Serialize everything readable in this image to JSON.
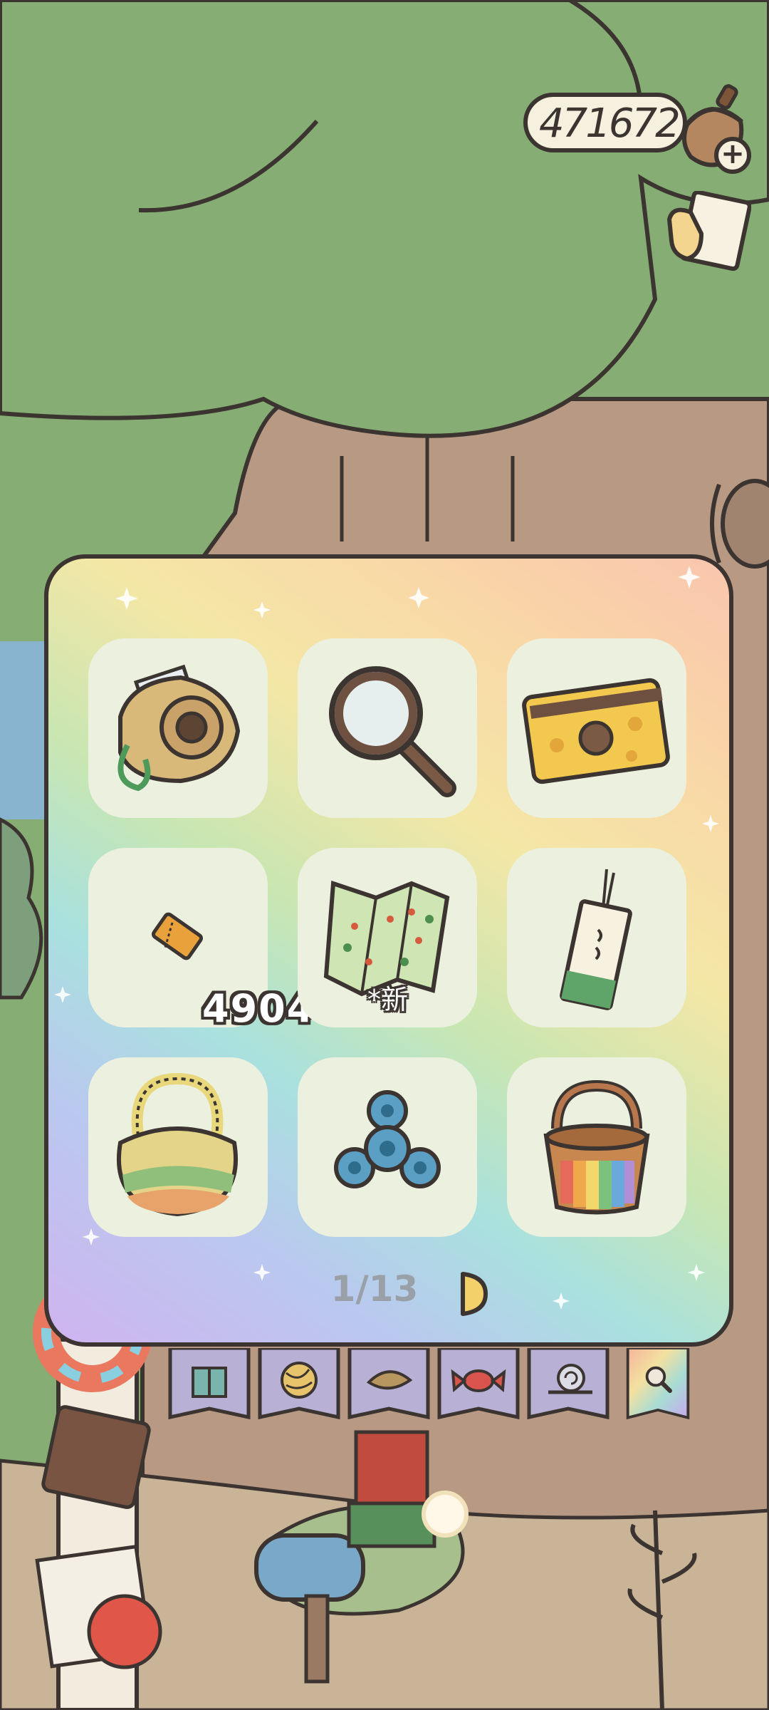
{
  "header": {
    "currency_value": "471672",
    "currency_icon": "acorn-icon",
    "add_icon": "plus-icon",
    "handbook_icon": "hand-note-icon"
  },
  "inventory": {
    "slots": [
      {
        "item": "instant-camera",
        "count": "",
        "tag": ""
      },
      {
        "item": "magnifying-glass",
        "count": "",
        "tag": ""
      },
      {
        "item": "acorn-card",
        "count": "",
        "tag": ""
      },
      {
        "item": "ticket",
        "count": "4904",
        "tag": ""
      },
      {
        "item": "map",
        "count": "",
        "tag": "*新"
      },
      {
        "item": "bookmark-charm",
        "count": "",
        "tag": ""
      },
      {
        "item": "rainbow-fur-bag",
        "count": "",
        "tag": ""
      },
      {
        "item": "fidget-spinner",
        "count": "",
        "tag": ""
      },
      {
        "item": "rainbow-bucket",
        "count": "",
        "tag": ""
      }
    ],
    "page_indicator": "1/13"
  },
  "tabs": [
    {
      "name": "gifts",
      "icon": "gift-icon"
    },
    {
      "name": "yarn",
      "icon": "yarn-ball-icon"
    },
    {
      "name": "leaves",
      "icon": "leaf-icon"
    },
    {
      "name": "candy",
      "icon": "candy-icon"
    },
    {
      "name": "snail",
      "icon": "snail-icon"
    },
    {
      "name": "tools",
      "icon": "magnifier-icon",
      "selected": true
    }
  ],
  "colors": {
    "outline": "#3b3430",
    "foliage": "#86ad73",
    "trunk": "#b89a84",
    "slot_bg": "#ecf0df"
  }
}
